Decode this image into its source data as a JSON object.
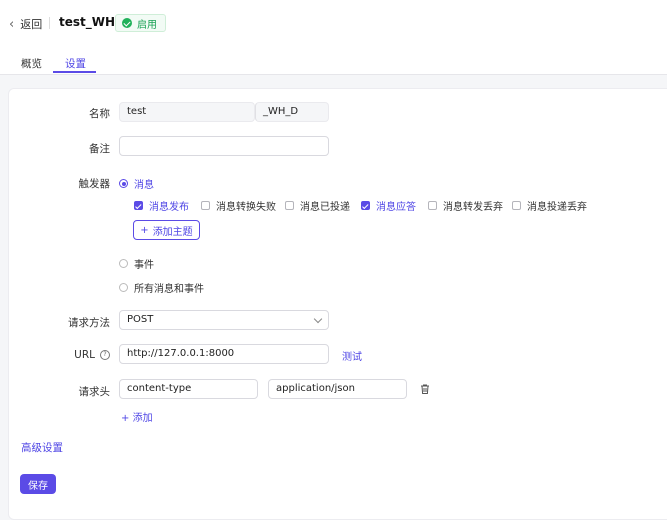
{
  "header": {
    "back_label": "返回",
    "title": "test_WH_D",
    "status_label": "启用",
    "status_color": "#20b15a"
  },
  "tabs": [
    {
      "label": "概览",
      "active": false
    },
    {
      "label": "设置",
      "active": true
    }
  ],
  "form": {
    "name": {
      "label": "名称",
      "value": "test",
      "suffix": "_WH_D"
    },
    "remark": {
      "label": "备注",
      "value": ""
    },
    "trigger": {
      "label": "触发器",
      "options": [
        {
          "label": "消息",
          "selected": true
        },
        {
          "label": "事件",
          "selected": false
        },
        {
          "label": "所有消息和事件",
          "selected": false
        }
      ],
      "message_types": [
        {
          "label": "消息发布",
          "checked": true
        },
        {
          "label": "消息转换失败",
          "checked": false
        },
        {
          "label": "消息已投递",
          "checked": false
        },
        {
          "label": "消息应答",
          "checked": true
        },
        {
          "label": "消息转发丢弃",
          "checked": false
        },
        {
          "label": "消息投递丢弃",
          "checked": false
        }
      ],
      "add_topic_label": "添加主题"
    },
    "method": {
      "label": "请求方法",
      "value": "POST"
    },
    "url": {
      "label": "URL",
      "value": "http://127.0.0.1:8000",
      "test_label": "测试"
    },
    "headers": {
      "label": "请求头",
      "rows": [
        {
          "key": "content-type",
          "value": "application/json"
        }
      ],
      "add_label": "添加"
    }
  },
  "advanced_label": "高级设置",
  "save_label": "保存",
  "accent_color": "#5b4be6"
}
